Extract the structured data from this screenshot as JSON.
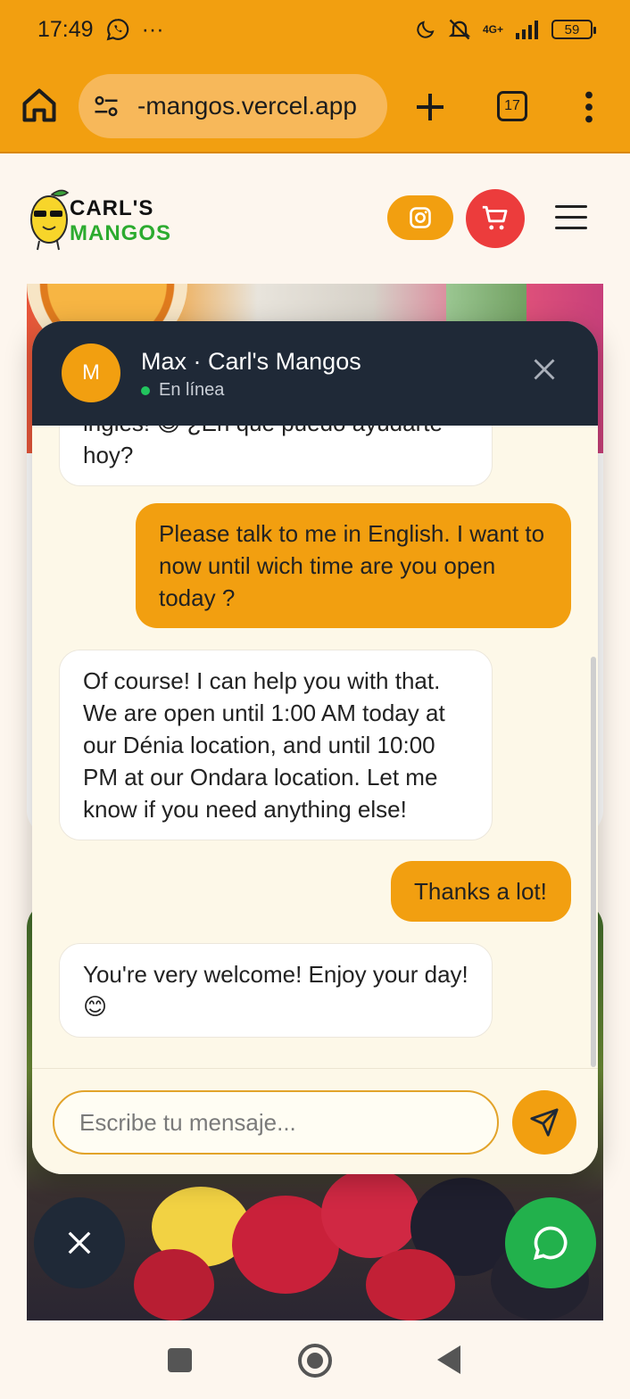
{
  "status_bar": {
    "time": "17:49",
    "more": "···",
    "network": "4G+",
    "battery": "59"
  },
  "browser": {
    "url": "-mangos.vercel.app",
    "tab_count": "17"
  },
  "site": {
    "logo_line1": "CARL'S",
    "logo_line2": "MANGOS"
  },
  "chat": {
    "avatar_letter": "M",
    "title": "Max · Carl's Mangos",
    "status": "En línea",
    "messages": [
      {
        "role": "bot",
        "text": "inglés! 😊 ¿En qué puedo ayudarte hoy?"
      },
      {
        "role": "user",
        "text": "Please talk to me in English. I want to now until wich time are you open today ?"
      },
      {
        "role": "bot",
        "text": "Of course! I can help you with that. We are open until 1:00 AM today at our Dénia location, and until 10:00 PM at our Ondara location. Let me know if you need anything else!"
      },
      {
        "role": "user",
        "text": "Thanks a lot!"
      },
      {
        "role": "bot",
        "text": "You're very welcome! Enjoy your day! 😊"
      }
    ],
    "input_placeholder": "Escribe tu mensaje..."
  },
  "colors": {
    "brand_orange": "#f29f10",
    "header_dark": "#1f2937",
    "online_green": "#22c55e",
    "whatsapp_green": "#22b14c",
    "cart_red": "#ec3c3c"
  }
}
